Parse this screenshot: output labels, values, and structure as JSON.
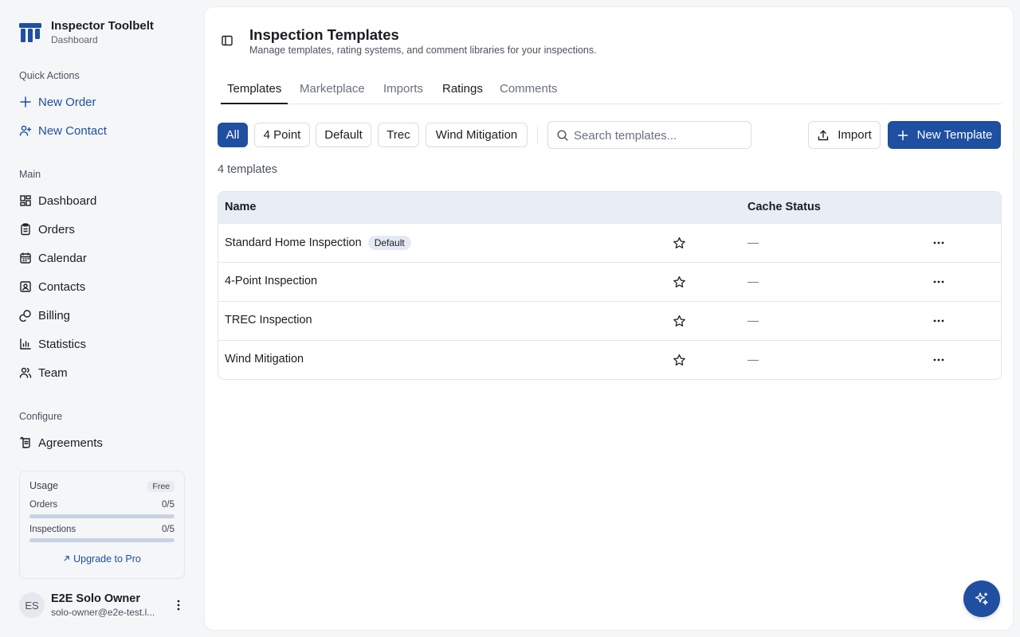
{
  "app": {
    "title": "Inspector Toolbelt",
    "subtitle": "Dashboard"
  },
  "sidebar": {
    "quick_actions_label": "Quick Actions",
    "quick_actions": [
      {
        "label": "New Order",
        "icon": "plus-icon"
      },
      {
        "label": "New Contact",
        "icon": "user-plus-icon"
      }
    ],
    "main_label": "Main",
    "main_items": [
      {
        "label": "Dashboard",
        "icon": "dashboard-icon"
      },
      {
        "label": "Orders",
        "icon": "clipboard-icon"
      },
      {
        "label": "Calendar",
        "icon": "calendar-icon"
      },
      {
        "label": "Contacts",
        "icon": "contact-card-icon"
      },
      {
        "label": "Billing",
        "icon": "coins-icon"
      },
      {
        "label": "Statistics",
        "icon": "bar-chart-icon"
      },
      {
        "label": "Team",
        "icon": "users-icon"
      }
    ],
    "configure_label": "Configure",
    "configure_items": [
      {
        "label": "Agreements",
        "icon": "scroll-icon"
      }
    ],
    "usage": {
      "title": "Usage",
      "plan": "Free",
      "orders_label": "Orders",
      "orders_value": "0/5",
      "orders_fraction": 0,
      "inspections_label": "Inspections",
      "inspections_value": "0/5",
      "inspections_fraction": 0,
      "upgrade_label": "Upgrade to Pro"
    },
    "user": {
      "initials": "ES",
      "name": "E2E Solo Owner",
      "email": "solo-owner@e2e-test.l..."
    }
  },
  "page": {
    "title": "Inspection Templates",
    "subtitle": "Manage templates, rating systems, and comment libraries for your inspections."
  },
  "tabs": [
    "Templates",
    "Marketplace",
    "Imports",
    "Ratings",
    "Comments"
  ],
  "filters": [
    "All",
    "4 Point",
    "Default",
    "Trec",
    "Wind Mitigation"
  ],
  "search": {
    "placeholder": "Search templates..."
  },
  "actions": {
    "import_label": "Import",
    "new_label": "New Template"
  },
  "count_text": "4 templates",
  "table": {
    "columns": {
      "name": "Name",
      "cache": "Cache Status"
    },
    "rows": [
      {
        "name": "Standard Home Inspection",
        "badge": "Default",
        "cache": "—"
      },
      {
        "name": "4-Point Inspection",
        "badge": "",
        "cache": "—"
      },
      {
        "name": "TREC Inspection",
        "badge": "",
        "cache": "—"
      },
      {
        "name": "Wind Mitigation",
        "badge": "",
        "cache": "—"
      }
    ]
  },
  "colors": {
    "primary": "#1f4fa0",
    "background": "#f5f6f8",
    "header_row": "#e9edf5"
  }
}
